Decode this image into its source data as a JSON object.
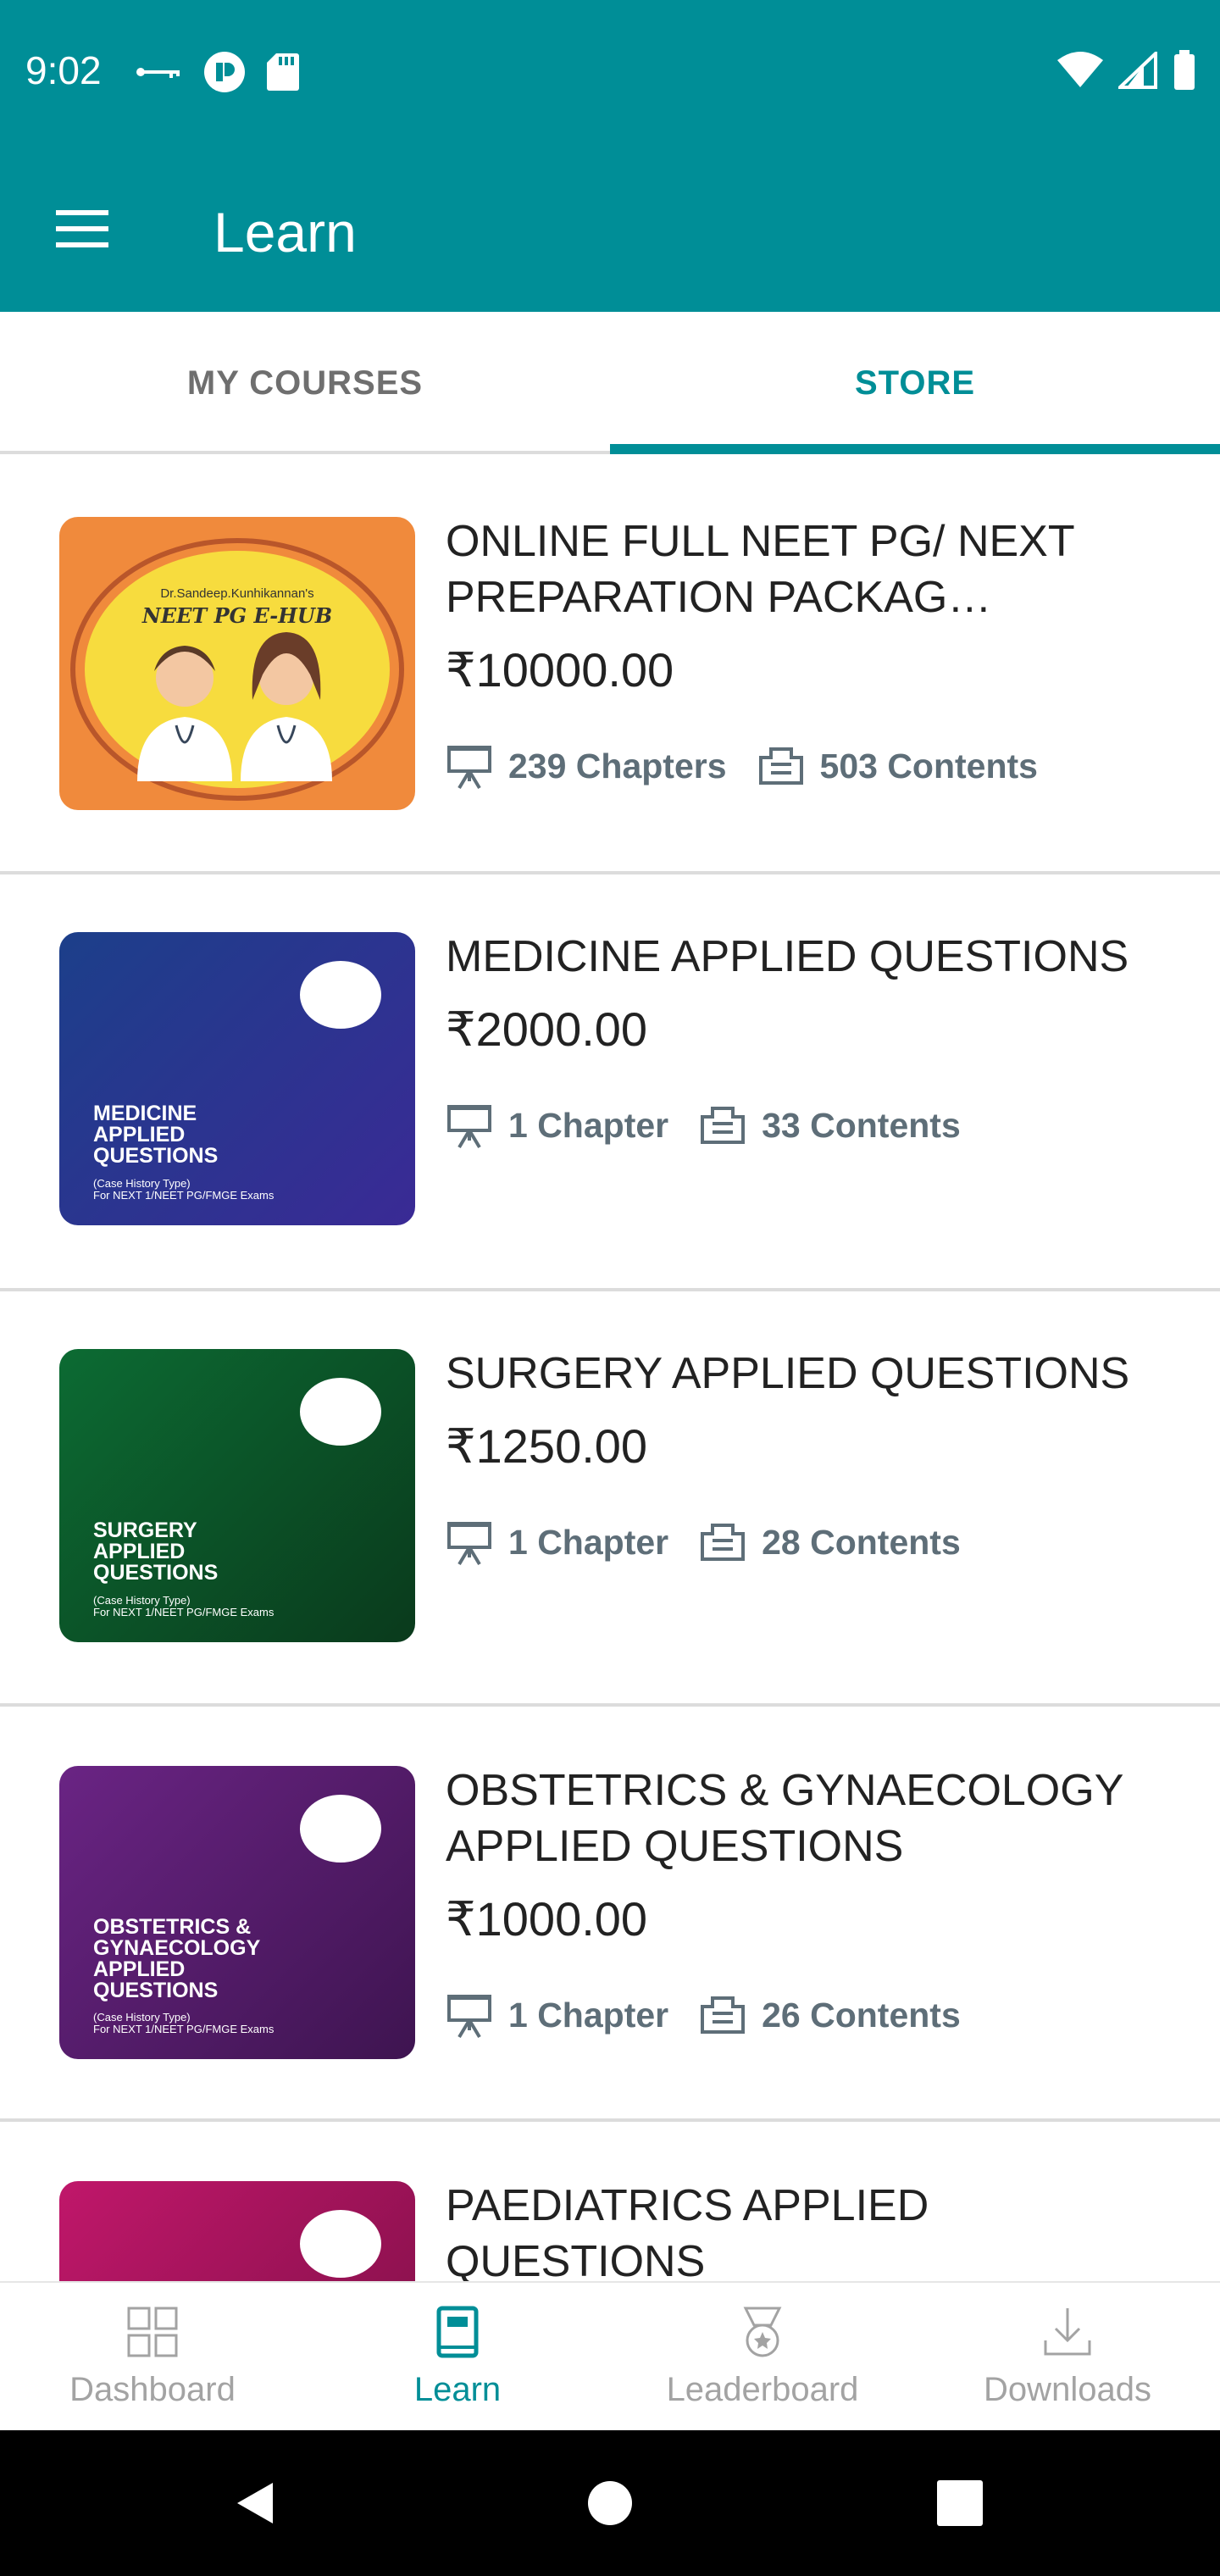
{
  "status_bar": {
    "time": "9:02"
  },
  "app_bar": {
    "title": "Learn"
  },
  "tabs": [
    {
      "label": "MY COURSES",
      "active": false
    },
    {
      "label": "STORE",
      "active": true
    }
  ],
  "courses": [
    {
      "title": "ONLINE FULL NEET PG/ NEXT PREPARATION PACKAG…",
      "price": "₹10000.00",
      "chapters": "239 Chapters",
      "contents": "503 Contents",
      "thumb": {
        "brand_small": "Dr.Sandeep.Kunhikannan's",
        "brand": "NEET PG E-HUB",
        "bg": "#f08a3c"
      }
    },
    {
      "title": "MEDICINE APPLIED QUESTIONS",
      "price": "₹2000.00",
      "chapters": "1 Chapter",
      "contents": "33 Contents",
      "thumb": {
        "heading": "MEDICINE\nAPPLIED\nQUESTIONS",
        "sub1": "(Case History Type)",
        "sub2": "For NEXT 1/NEET PG/FMGE Exams",
        "bg": "#2b2f8f"
      }
    },
    {
      "title": "SURGERY APPLIED QUESTIONS",
      "price": "₹1250.00",
      "chapters": "1 Chapter",
      "contents": "28 Contents",
      "thumb": {
        "heading": "SURGERY\nAPPLIED\nQUESTIONS",
        "sub1": "(Case History Type)",
        "sub2": "For NEXT 1/NEET PG/FMGE Exams",
        "bg": "#0f5e2c"
      }
    },
    {
      "title": "OBSTETRICS & GYNAECOLOGY APPLIED QUESTIONS",
      "price": "₹1000.00",
      "chapters": "1 Chapter",
      "contents": "26 Contents",
      "thumb": {
        "heading": "OBSTETRICS &\nGYNAECOLOGY\nAPPLIED\nQUESTIONS",
        "sub1": "(Case History Type)",
        "sub2": "For NEXT 1/NEET PG/FMGE Exams",
        "bg": "#5a1f6e"
      }
    },
    {
      "title": "PAEDIATRICS APPLIED QUESTIONS",
      "thumb": {
        "bg": "#b0175f"
      }
    }
  ],
  "bottom_nav": [
    {
      "label": "Dashboard",
      "icon": "dashboard-icon",
      "active": false
    },
    {
      "label": "Learn",
      "icon": "book-icon",
      "active": true
    },
    {
      "label": "Leaderboard",
      "icon": "medal-icon",
      "active": false
    },
    {
      "label": "Downloads",
      "icon": "download-icon",
      "active": false
    }
  ],
  "colors": {
    "primary": "#008e97",
    "text": "#222222",
    "meta": "#5e6e78",
    "inactive": "#a3a3a3"
  }
}
